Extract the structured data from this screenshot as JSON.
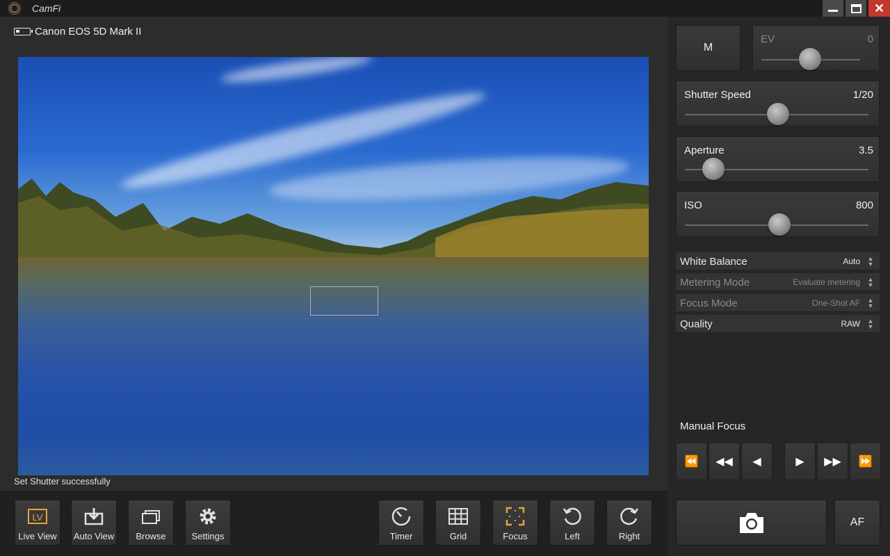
{
  "window": {
    "title": "CamFi"
  },
  "camera": {
    "name": "Canon EOS 5D Mark II"
  },
  "status": {
    "message": "Set Shutter successfully"
  },
  "toolbar_left": [
    {
      "label": "Live View",
      "icon": "live-view-icon",
      "active": true
    },
    {
      "label": "Auto View",
      "icon": "auto-view-icon"
    },
    {
      "label": "Browse",
      "icon": "browse-icon"
    },
    {
      "label": "Settings",
      "icon": "gear-icon"
    }
  ],
  "toolbar_right": [
    {
      "label": "Timer",
      "icon": "timer-icon"
    },
    {
      "label": "Grid",
      "icon": "grid-icon"
    },
    {
      "label": "Focus",
      "icon": "focus-icon",
      "active": true
    },
    {
      "label": "Left",
      "icon": "rotate-left-icon"
    },
    {
      "label": "Right",
      "icon": "rotate-right-icon"
    }
  ],
  "exposure": {
    "mode": "M",
    "ev": {
      "label": "EV",
      "value": "0",
      "level": 0.5
    },
    "shutter_speed": {
      "label": "Shutter Speed",
      "value": "1/20",
      "level": 0.5
    },
    "aperture": {
      "label": "Aperture",
      "value": "3.5",
      "level": 0.15
    },
    "iso": {
      "label": "ISO",
      "value": "800",
      "level": 0.5
    }
  },
  "settings": [
    {
      "label": "White Balance",
      "value": "Auto",
      "enabled": true
    },
    {
      "label": "Metering Mode",
      "value": "Evaluate metering",
      "enabled": false
    },
    {
      "label": "Focus Mode",
      "value": "One-Shot AF",
      "enabled": false
    },
    {
      "label": "Quality",
      "value": "RAW",
      "enabled": true
    }
  ],
  "manual_focus": {
    "title": "Manual Focus",
    "buttons": [
      "⏪",
      "◀◀",
      "◀",
      "▶",
      "▶▶",
      "⏩"
    ]
  },
  "capture": {
    "af_label": "AF"
  },
  "colors": {
    "accent": "#e8a33c",
    "background": "#262626",
    "panel": "#333333"
  }
}
